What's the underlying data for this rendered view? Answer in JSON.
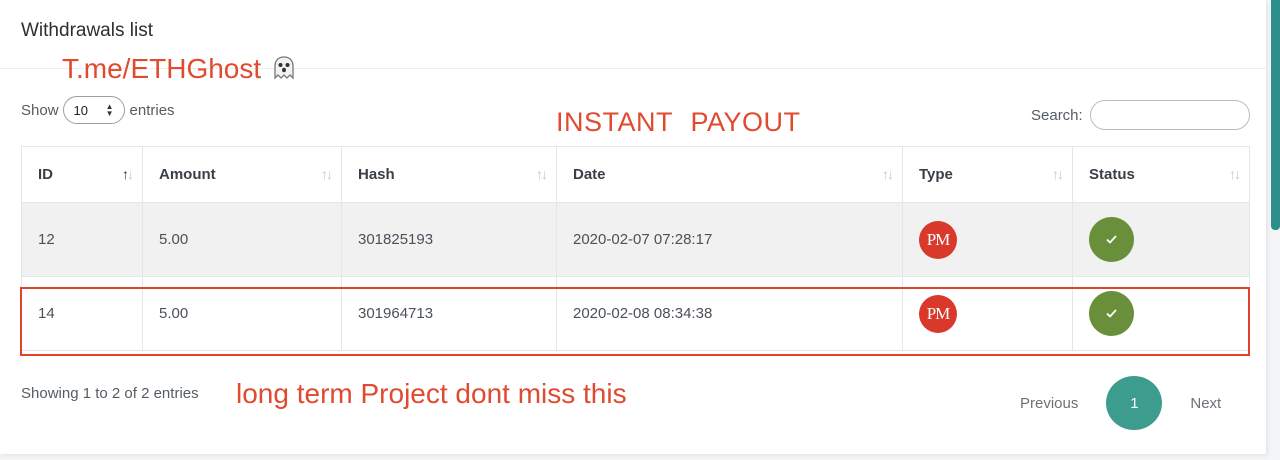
{
  "card": {
    "title": "Withdrawals list"
  },
  "overlays": {
    "telegram": "T.me/ETHGhost",
    "instant": "INSTANT PAYOUT",
    "long_term": "long term Project dont miss this"
  },
  "length": {
    "prefix": "Show",
    "value": "10",
    "suffix": "entries"
  },
  "search": {
    "label": "Search:",
    "value": ""
  },
  "table": {
    "columns": [
      "ID",
      "Amount",
      "Hash",
      "Date",
      "Type",
      "Status"
    ],
    "sorted_column": "ID",
    "rows": [
      {
        "id": "12",
        "amount": "5.00",
        "hash": "301825193",
        "date": "2020-02-07 07:28:17",
        "type": "PM",
        "status_icon": "check-icon"
      },
      {
        "id": "14",
        "amount": "5.00",
        "hash": "301964713",
        "date": "2020-02-08 08:34:38",
        "type": "PM",
        "status_icon": "check-icon"
      }
    ]
  },
  "info": "Showing 1 to 2 of 2 entries",
  "pagination": {
    "previous": "Previous",
    "current": "1",
    "next": "Next"
  },
  "colors": {
    "accent": "#3c9d8e",
    "pm_red": "#d8392b",
    "status_green": "#6a8f3a",
    "overlay_red": "#e04a2f"
  }
}
